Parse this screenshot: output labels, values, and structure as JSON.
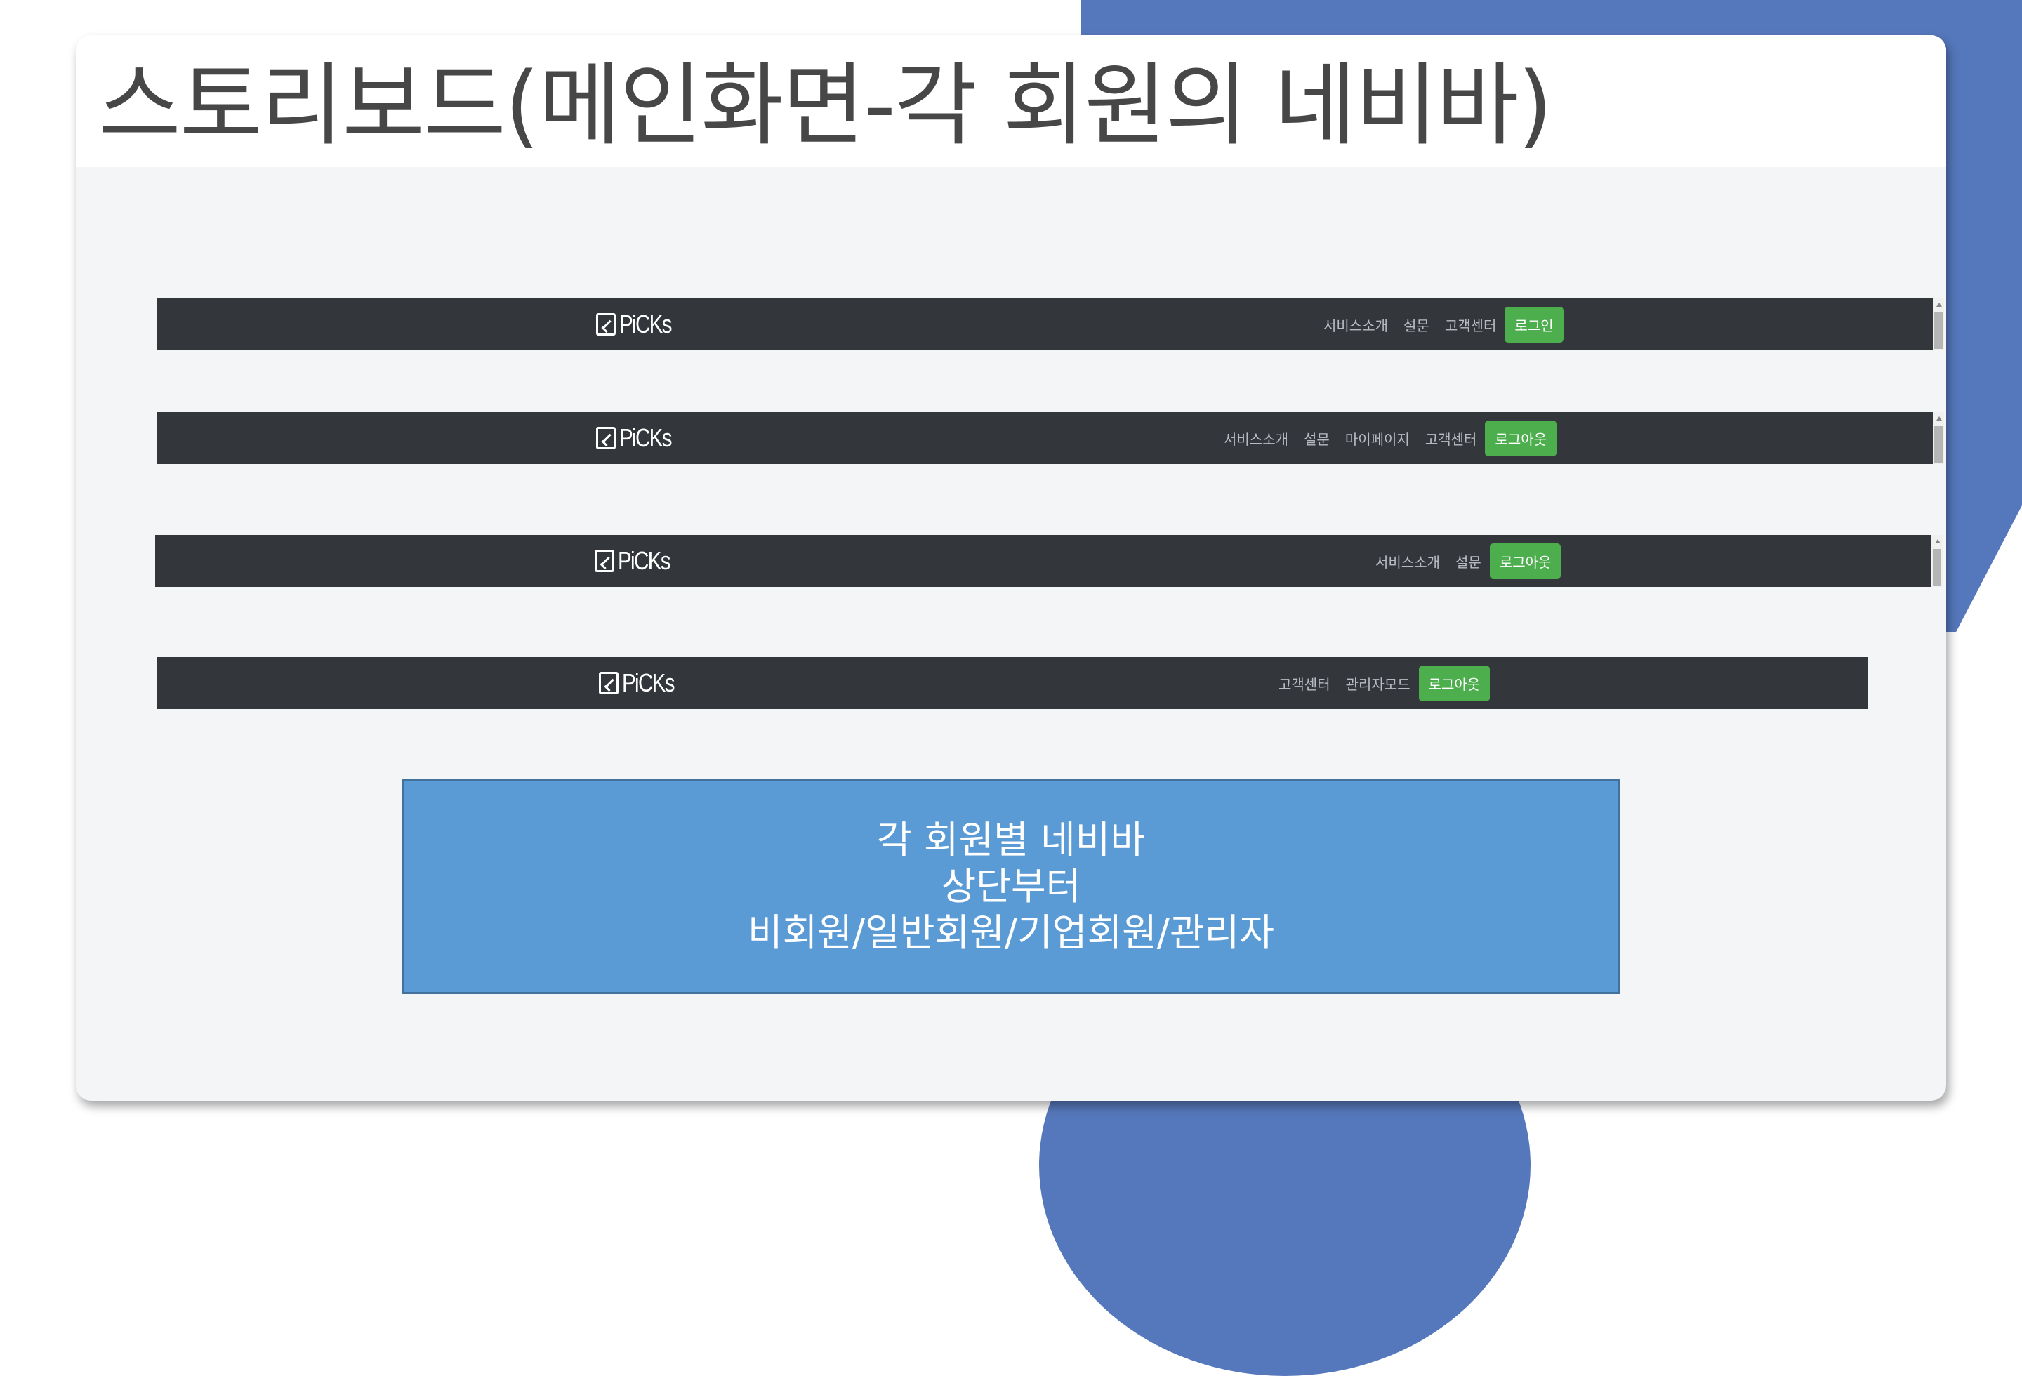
{
  "slide": {
    "title": "스토리보드(메인화면-각 회원의 네비바)"
  },
  "navbars": [
    {
      "role": "비회원",
      "logo": "PiCKs",
      "links": [
        "서비스소개",
        "설문",
        "고객센터"
      ],
      "button": "로그인",
      "scrollbar": true
    },
    {
      "role": "일반회원",
      "logo": "PiCKs",
      "links": [
        "서비스소개",
        "설문",
        "마이페이지",
        "고객센터"
      ],
      "button": "로그아웃",
      "scrollbar": true
    },
    {
      "role": "기업회원",
      "logo": "PiCKs",
      "links": [
        "서비스소개",
        "설문"
      ],
      "button": "로그아웃",
      "scrollbar": true
    },
    {
      "role": "관리자",
      "logo": "PiCKs",
      "links": [
        "고객센터",
        "관리자모드"
      ],
      "button": "로그아웃",
      "scrollbar": false
    }
  ],
  "info_box": {
    "lines": [
      "각 회원별 네비바",
      "상단부터",
      "비회원/일반회원/기업회원/관리자"
    ]
  },
  "colors": {
    "accent_blue": "#5577bb",
    "navbar_bg": "#33363b",
    "button_green": "#4cae4c",
    "info_box_bg": "#5b9bd5"
  }
}
